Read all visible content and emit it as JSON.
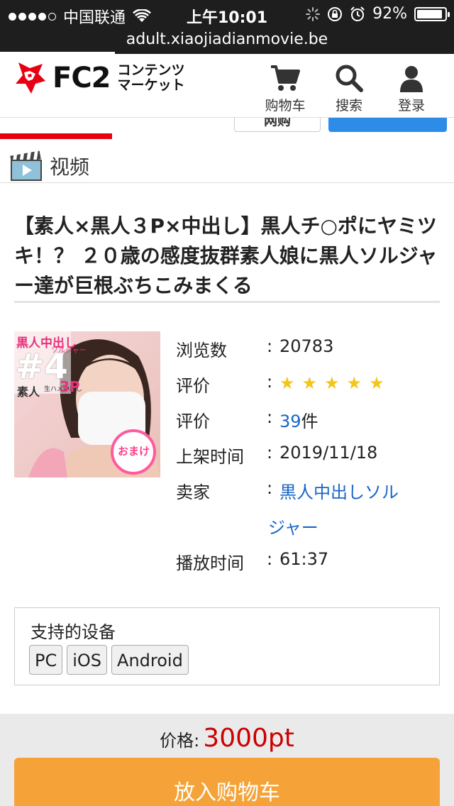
{
  "status_bar": {
    "carrier": "中国联通",
    "time": "上午10:01",
    "battery": "92%",
    "battery_level": 0.92
  },
  "browser": {
    "url": "adult.xiaojiadianmovie.be"
  },
  "site_header": {
    "logo_text": "FC2",
    "logo_sub_line1": "コンテンツ",
    "logo_sub_line2": "マーケット",
    "cart_label": "购物车",
    "search_label": "搜索",
    "login_label": "登录",
    "peek_button_label": "网购"
  },
  "category": {
    "label": "视频"
  },
  "product": {
    "title": "【素人×黒人３P×中出し】黒人チ○ポにヤミツキ！？ ２０歳の感度抜群素人娘に黒人ソルジャー達が巨根ぶちこみまくる",
    "thumbnail_text": {
      "top": "黒人中出し",
      "top_sub": "ソルジャー",
      "number": "#4",
      "tag": "素人",
      "tag_small": "生ハメ中出し",
      "tag_3p": "3P",
      "badge": "おまけ"
    },
    "info": {
      "views_label": "浏览数",
      "views_value": "20783",
      "rating_label": "评价",
      "rating_stars": "★ ★ ★ ★ ★",
      "reviews_label": "评价",
      "reviews_count": "39",
      "reviews_unit": "件",
      "date_label": "上架时间",
      "date_value": "2019/11/18",
      "seller_label": "卖家",
      "seller_line1": "黒人中出しソル",
      "seller_line2": "ジャー",
      "duration_label": "播放时间",
      "duration_value": "61:37",
      "colon": ":"
    }
  },
  "devices": {
    "title": "支持的设备",
    "items": [
      "PC",
      "iOS",
      "Android"
    ]
  },
  "purchase": {
    "price_label": "价格:",
    "price_value": "3000pt",
    "cart_button": "放入购物车"
  },
  "colors": {
    "accent_red": "#e60012",
    "link_blue": "#1a66c8",
    "price_red": "#c00000",
    "cart_orange": "#f5a338",
    "star_yellow": "#f5c518"
  }
}
